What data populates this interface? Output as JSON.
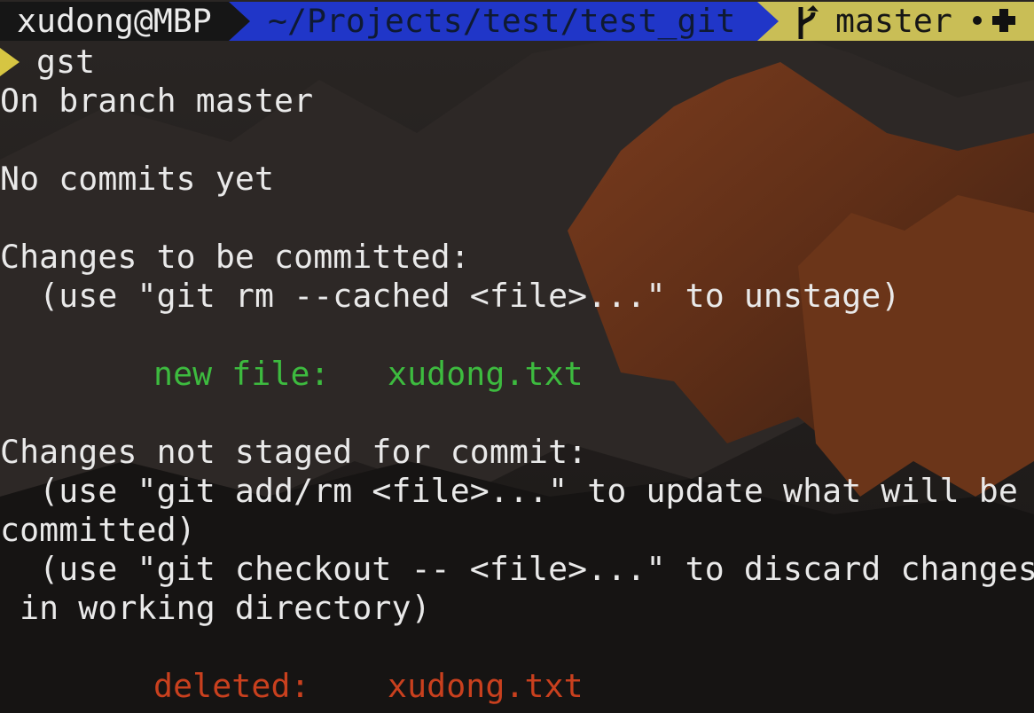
{
  "prompt": {
    "user_host": "xudong@MBP",
    "path": "~/Projects/test/test_git",
    "branch": "master",
    "branch_icon": "git-branch-icon",
    "status_dot_icon": "dot-icon",
    "status_plus_icon": "plus-icon",
    "prompt_icon": "prompt-triangle-icon",
    "colors": {
      "user_bg": "#161616",
      "path_bg": "#2036c8",
      "git_bg": "#c9be56",
      "prompt_arrow": "#d6c542",
      "staged": "#3dbb3f",
      "unstaged": "#c9401e"
    }
  },
  "command": "gst",
  "output": {
    "branch_line": "On branch master",
    "no_commits": "No commits yet",
    "staged_header": "Changes to be committed:",
    "staged_hint": "  (use \"git rm --cached <file>...\" to unstage)",
    "staged_label": "new file:",
    "staged_file": "xudong.txt",
    "unstaged_header": "Changes not staged for commit:",
    "unstaged_hint_1": "  (use \"git add/rm <file>...\" to update what will be",
    "unstaged_hint_1_wrap": "committed)",
    "unstaged_hint_2": "  (use \"git checkout -- <file>...\" to discard changes",
    "unstaged_hint_2_wrap": " in working directory)",
    "unstaged_label": "deleted:",
    "unstaged_file": "xudong.txt"
  }
}
